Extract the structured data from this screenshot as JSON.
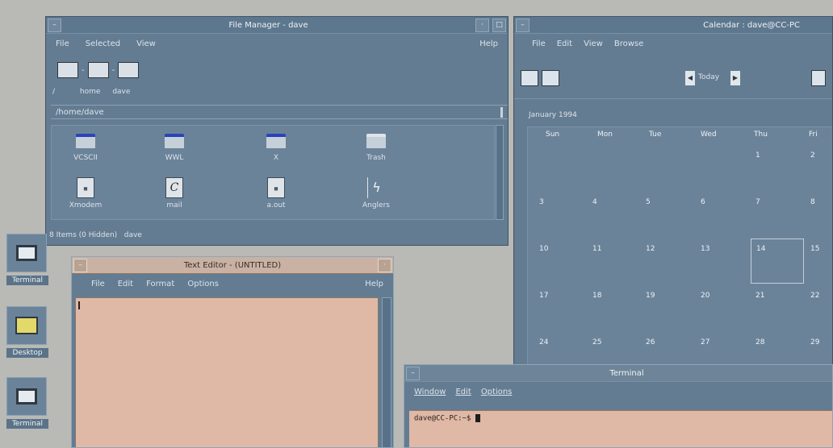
{
  "file_manager": {
    "title": "File Manager - dave",
    "menu": [
      "File",
      "Selected",
      "View"
    ],
    "help": "Help",
    "path_buttons": [
      "/",
      "home",
      "dave"
    ],
    "current_path": "/home/dave",
    "items": [
      "VCSCII",
      "WWL",
      "X",
      "Trash",
      "Xmodem",
      "mail",
      "a.out",
      "Anglers"
    ],
    "status": "8 Items (0 Hidden)   dave"
  },
  "calendar": {
    "title": "Calendar : dave@CC-PC",
    "menu": [
      "File",
      "Edit",
      "View",
      "Browse"
    ],
    "nav_label": "Today",
    "month": "January 1994",
    "day_headers": [
      "Sun",
      "Mon",
      "Tue",
      "Wed",
      "Thu",
      "Fri"
    ],
    "weeks": [
      [
        "",
        "",
        "",
        "",
        "1",
        "2"
      ],
      [
        "3",
        "4",
        "5",
        "6",
        "7",
        "8"
      ],
      [
        "10",
        "11",
        "12",
        "13",
        "14",
        "15"
      ],
      [
        "17",
        "18",
        "19",
        "20",
        "21",
        "22"
      ],
      [
        "24",
        "25",
        "26",
        "27",
        "28",
        "29"
      ]
    ],
    "today": "14"
  },
  "text_editor": {
    "title": "Text Editor - (UNTITLED)",
    "menu": [
      "File",
      "Edit",
      "Format",
      "Options"
    ],
    "help": "Help"
  },
  "terminal": {
    "title": "Terminal",
    "menu": [
      "Window",
      "Edit",
      "Options"
    ],
    "prompt": "dave@CC-PC:~$"
  },
  "desktop_icons": [
    "Terminal",
    "Desktop",
    "Terminal"
  ]
}
